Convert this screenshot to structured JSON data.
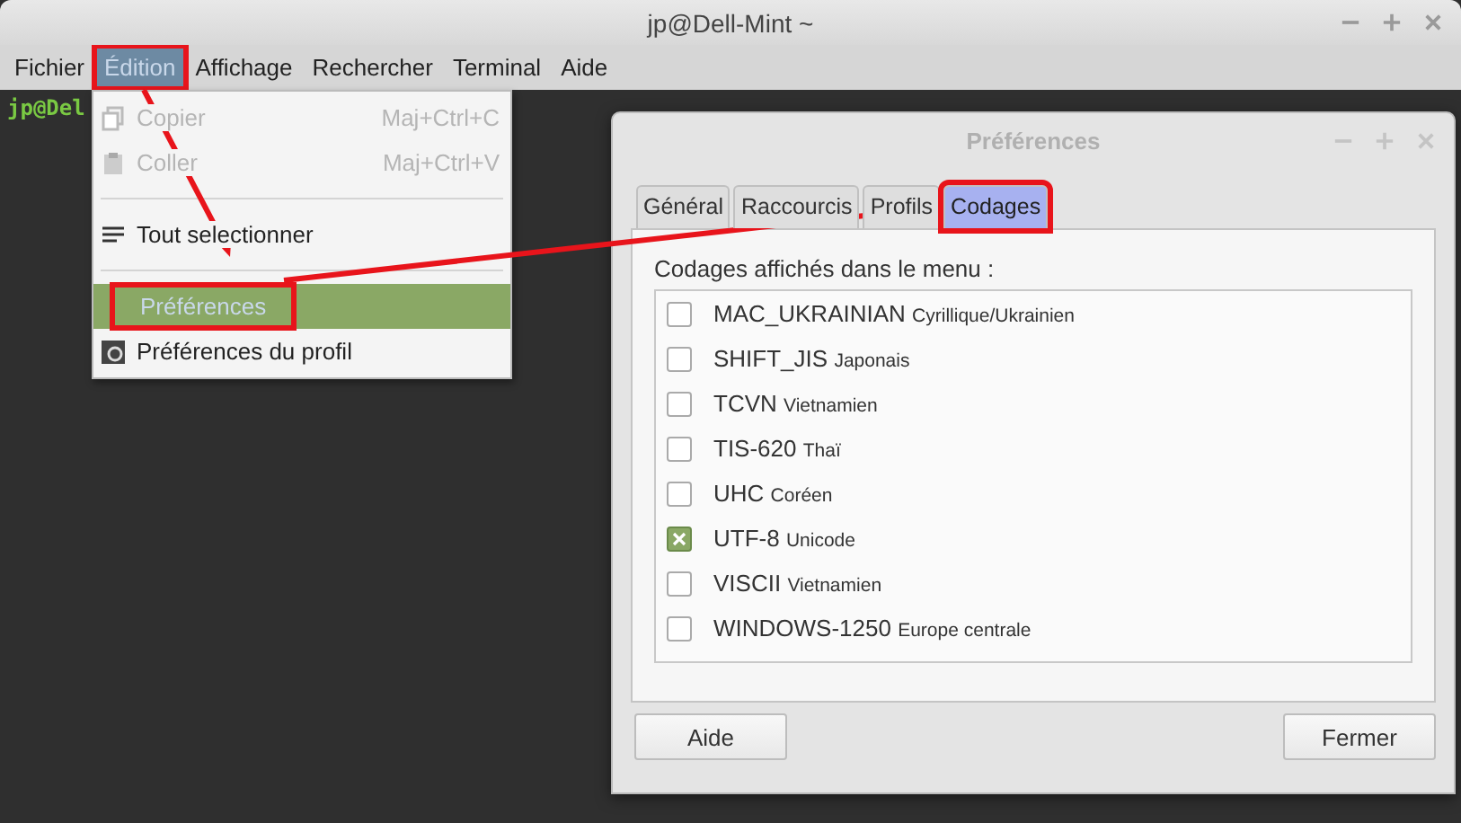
{
  "window": {
    "title": "jp@Dell-Mint ~"
  },
  "menubar": [
    {
      "label": "Fichier",
      "selected": false,
      "annotated": false
    },
    {
      "label": "Édition",
      "selected": true,
      "annotated": true
    },
    {
      "label": "Affichage",
      "selected": false,
      "annotated": false
    },
    {
      "label": "Rechercher",
      "selected": false,
      "annotated": false
    },
    {
      "label": "Terminal",
      "selected": false,
      "annotated": false
    },
    {
      "label": "Aide",
      "selected": false,
      "annotated": false
    }
  ],
  "terminal": {
    "prompt": "jp@Del"
  },
  "edit_menu": [
    {
      "kind": "copy",
      "label": "Copier",
      "shortcut": "Maj+Ctrl+C",
      "disabled": true,
      "selected": false,
      "annotated": false
    },
    {
      "kind": "paste",
      "label": "Coller",
      "shortcut": "Maj+Ctrl+V",
      "disabled": true,
      "selected": false,
      "annotated": false
    },
    {
      "kind": "separator"
    },
    {
      "kind": "select",
      "label": "Tout selectionner",
      "disabled": false,
      "selected": false,
      "annotated": false
    },
    {
      "kind": "separator"
    },
    {
      "kind": "plain",
      "label": "Préférences",
      "disabled": false,
      "selected": true,
      "annotated": true
    },
    {
      "kind": "profile",
      "label": "Préférences du profil",
      "disabled": false,
      "selected": false,
      "annotated": false
    }
  ],
  "dialog": {
    "title": "Préférences",
    "tabs": [
      {
        "label": "Général",
        "selected": false,
        "annotated": false
      },
      {
        "label": "Raccourcis",
        "selected": false,
        "annotated": false
      },
      {
        "label": "Profils",
        "selected": false,
        "annotated": false
      },
      {
        "label": "Codages",
        "selected": true,
        "annotated": true
      }
    ],
    "list_label": "Codages affichés dans le menu :",
    "encodings": [
      {
        "name": "MAC_UKRAINIAN",
        "description": "Cyrillique/Ukrainien",
        "checked": false
      },
      {
        "name": "SHIFT_JIS",
        "description": "Japonais",
        "checked": false
      },
      {
        "name": "TCVN",
        "description": "Vietnamien",
        "checked": false
      },
      {
        "name": "TIS-620",
        "description": "Thaï",
        "checked": false
      },
      {
        "name": "UHC",
        "description": "Coréen",
        "checked": false
      },
      {
        "name": "UTF-8",
        "description": "Unicode",
        "checked": true
      },
      {
        "name": "VISCII",
        "description": "Vietnamien",
        "checked": false
      },
      {
        "name": "WINDOWS-1250",
        "description": "Europe centrale",
        "checked": false
      }
    ],
    "buttons": [
      "Aide",
      "Fermer"
    ]
  }
}
